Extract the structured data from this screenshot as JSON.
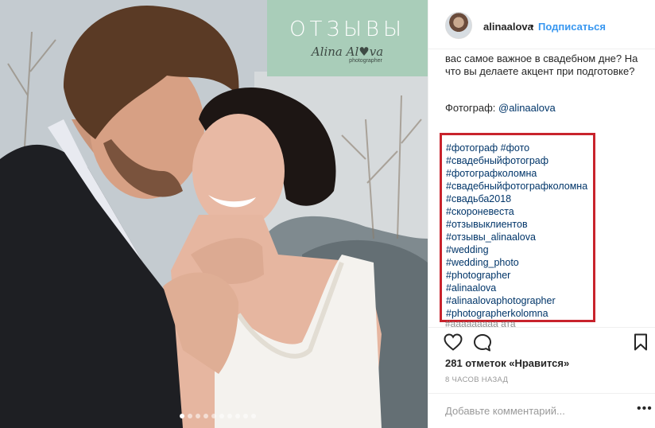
{
  "promo": {
    "title": "ОТЗЫВЫ",
    "logo": "Alina Al♥va",
    "logo_sub": "photographer"
  },
  "carousel": {
    "count": 10,
    "active": 0
  },
  "header": {
    "username": "alinaalova",
    "separator": "•",
    "follow_label": "Подписаться"
  },
  "caption": {
    "lines": [
      "вас самое важное в свадебном дне? На",
      "что вы делаете акцент при подготовке?"
    ],
    "photographer_label": "Фотограф: ",
    "photographer_handle": "@alinaalova"
  },
  "hashtags": [
    "#фотограф #фото",
    "#свадебныйфотограф",
    "#фотографколомна",
    "#свадебныйфотографколомна",
    "#свадьба2018",
    "#скороневеста",
    "#отзывыклиентов",
    "#отзывы_alinaalova",
    "#wedding",
    "#wedding_photo",
    "#photographer",
    "#alinaalova",
    "#alinaalovaphotographer",
    "#photographerkolomna"
  ],
  "hashtag_cut": "#ааааааааа ата",
  "likes": "281 отметок «Нравится»",
  "timestamp": "8 ЧАСОВ НАЗАД",
  "comment": {
    "placeholder": "Добавьте комментарий...",
    "more": "•••"
  },
  "colors": {
    "link": "#003569",
    "follow": "#3897f0",
    "highlight_box": "#c8232c",
    "promo_panel": "#a9cdb9"
  },
  "icons": [
    "heart-icon",
    "comment-icon",
    "bookmark-icon",
    "more-options-icon"
  ]
}
